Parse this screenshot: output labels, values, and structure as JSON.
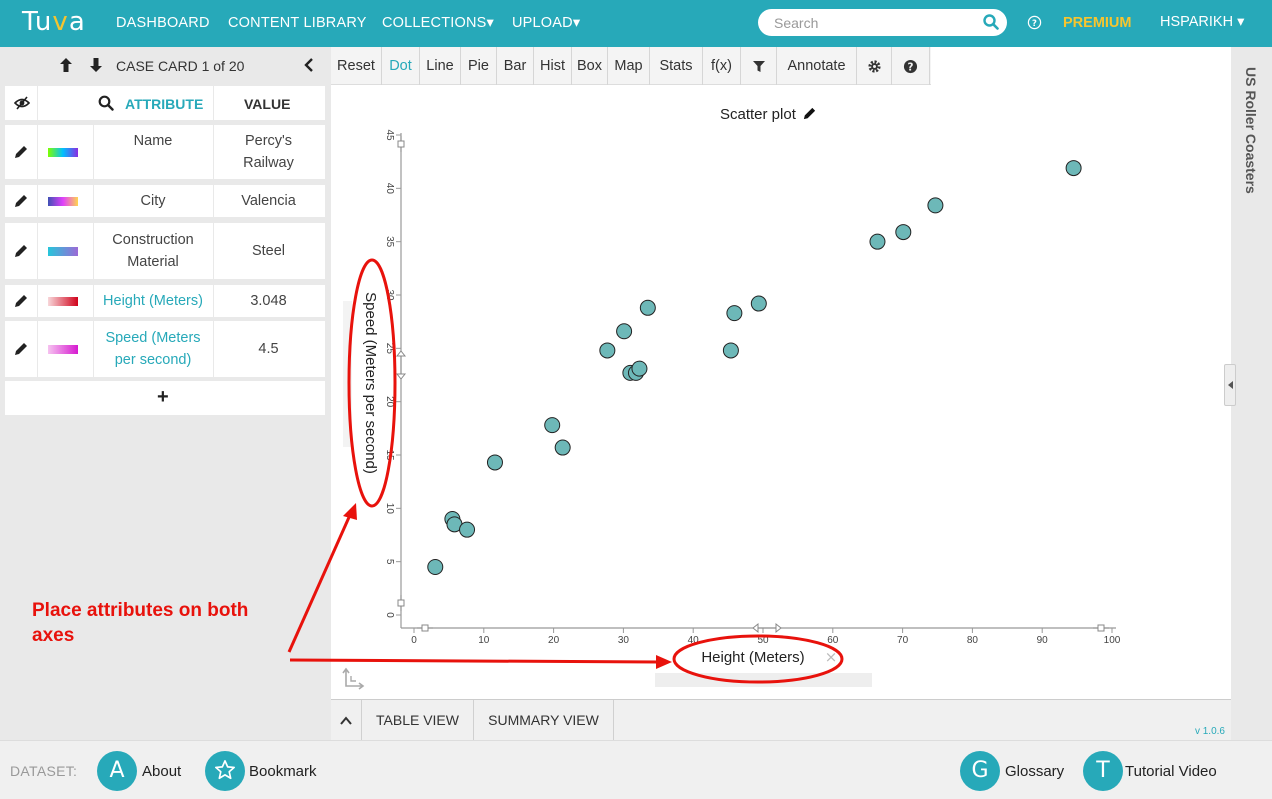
{
  "nav": {
    "logo": "Tuva",
    "links": [
      "DASHBOARD",
      "CONTENT LIBRARY",
      "COLLECTIONS▾",
      "UPLOAD▾"
    ],
    "search_placeholder": "Search",
    "premium": "PREMIUM",
    "user": "HSPARIKH ▾"
  },
  "case_card": {
    "title": "CASE CARD 1 of 20",
    "header_attr": "ATTRIBUTE",
    "header_value": "VALUE",
    "rows": [
      {
        "name": "Name",
        "value": "Percy's Railway",
        "linked": false,
        "colors": [
          "#7fff00",
          "#00bfff",
          "#8a2be2"
        ]
      },
      {
        "name": "City",
        "value": "Valencia",
        "linked": false,
        "colors": [
          "#3f51b5",
          "#e040fb",
          "#ffd54f"
        ]
      },
      {
        "name": "Construction Material",
        "value": "Steel",
        "linked": false,
        "colors": [
          "#26c6da",
          "#9c6ad6"
        ]
      },
      {
        "name": "Height (Meters)",
        "value": "3.048",
        "linked": true,
        "colors": [
          "#f8d7da",
          "#d0021b"
        ]
      },
      {
        "name": "Speed (Meters per second)",
        "value": "4.5",
        "linked": true,
        "colors": [
          "#f6c3f0",
          "#d61ad0"
        ]
      }
    ],
    "add_label": "+"
  },
  "toolbar": {
    "buttons": [
      "Reset",
      "Dot",
      "Line",
      "Pie",
      "Bar",
      "Hist",
      "Box",
      "Map",
      "Stats",
      "f(x)",
      "",
      "Annotate",
      "",
      ""
    ],
    "active": "Dot"
  },
  "right_panel": {
    "dataset_name": "US Roller Coasters"
  },
  "bottom_tabs": {
    "table_view": "TABLE VIEW",
    "summary_view": "SUMMARY VIEW",
    "version": "v 1.0.6"
  },
  "footer": {
    "dataset_label": "DATASET:",
    "about_letter": "A",
    "about": "About",
    "bookmark": "Bookmark",
    "glossary_letter": "G",
    "glossary": "Glossary",
    "tutorial_letter": "T",
    "tutorial": "Tutorial Video"
  },
  "annotation": {
    "text": "Place attributes on both axes",
    "color": "#e8120c"
  },
  "chart_data": {
    "type": "scatter",
    "title": "Scatter plot",
    "xlabel": "Height (Meters)",
    "ylabel": "Speed (Meters per second)",
    "xlim": [
      0,
      100
    ],
    "ylim": [
      0,
      45
    ],
    "xticks": [
      0,
      10,
      20,
      30,
      40,
      50,
      60,
      70,
      80,
      90,
      100
    ],
    "yticks": [
      0,
      5,
      10,
      15,
      20,
      25,
      30,
      35,
      40,
      45
    ],
    "grid": false,
    "point_color": "#6db8b8",
    "x": [
      3.048,
      5.5,
      5.8,
      7.6,
      11.6,
      19.8,
      21.3,
      27.7,
      30.1,
      31.0,
      31.8,
      32.3,
      33.5,
      45.4,
      45.9,
      49.4,
      66.4,
      70.1,
      74.7,
      94.5
    ],
    "y": [
      4.5,
      9.0,
      8.5,
      8.0,
      14.3,
      17.8,
      15.7,
      24.8,
      26.6,
      22.7,
      22.7,
      23.1,
      28.8,
      24.8,
      28.3,
      29.2,
      35.0,
      35.9,
      38.4,
      41.9
    ]
  }
}
